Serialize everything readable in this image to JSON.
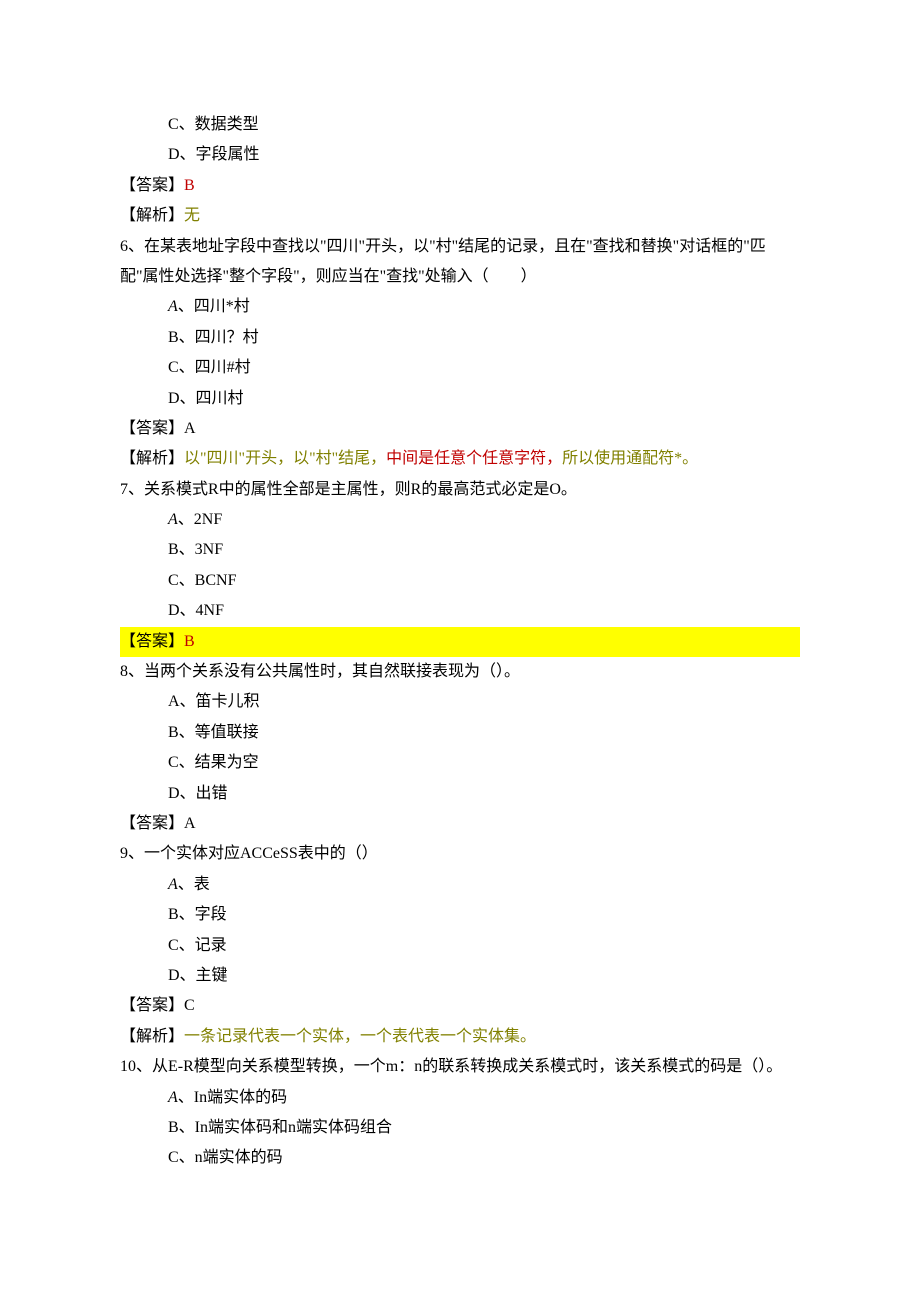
{
  "q5": {
    "optC": "C、数据类型",
    "optD": "D、字段属性",
    "ansLabel": "【答案】",
    "ansVal": "B",
    "anaLabel": "【解析】",
    "anaVal": "无"
  },
  "q6": {
    "stem": "6、在某表地址字段中查找以\"四川\"开头，以\"村\"结尾的记录，且在\"查找和替换\"对话框的\"匹配\"属性处选择\"整个字段\"，则应当在\"查找\"处输入（　　）",
    "optA_prefix": "A",
    "optA_rest": "、四川*村",
    "optB": "B、四川？村",
    "optC": "C、四川#村",
    "optD": "D、四川村",
    "ansLabel": "【答案】",
    "ansVal": "A",
    "anaLabel": "【解析】",
    "ana1": "以\"四川\"开头，以\"村\"结尾，",
    "ana2": "中间是任意个任意字符，",
    "ana3": "所以使用通配符*。"
  },
  "q7": {
    "stem": "7、关系模式R中的属性全部是主属性，则R的最高范式必定是O。",
    "optA_prefix": "A",
    "optA_rest": "、2NF",
    "optB": "B、3NF",
    "optC": "C、BCNF",
    "optD": "D、4NF",
    "ansLabel": "【答案】",
    "ansVal": "B"
  },
  "q8": {
    "stem": "8、当两个关系没有公共属性时，其自然联接表现为（）。",
    "optA": "A、笛卡儿积",
    "optB": "B、等值联接",
    "optC": "C、结果为空",
    "optD": "D、出错",
    "ansLabel": "【答案】",
    "ansVal": "A"
  },
  "q9": {
    "stem": "9、一个实体对应ACCeSS表中的（）",
    "optA_prefix": "A",
    "optA_rest": "、表",
    "optB": "B、字段",
    "optC": "C、记录",
    "optD": "D、主键",
    "ansLabel": "【答案】",
    "ansVal": "C",
    "anaLabel": "【解析】",
    "anaVal": "一条记录代表一个实体，一个表代表一个实体集。"
  },
  "q10": {
    "stem": "10、从E-R模型向关系模型转换，一个m：n的联系转换成关系模式时，该关系模式的码是（）。",
    "optA_prefix": "A",
    "optA_rest": "、In端实体的码",
    "optB": "B、In端实体码和n端实体码组合",
    "optC": "C、n端实体的码"
  }
}
